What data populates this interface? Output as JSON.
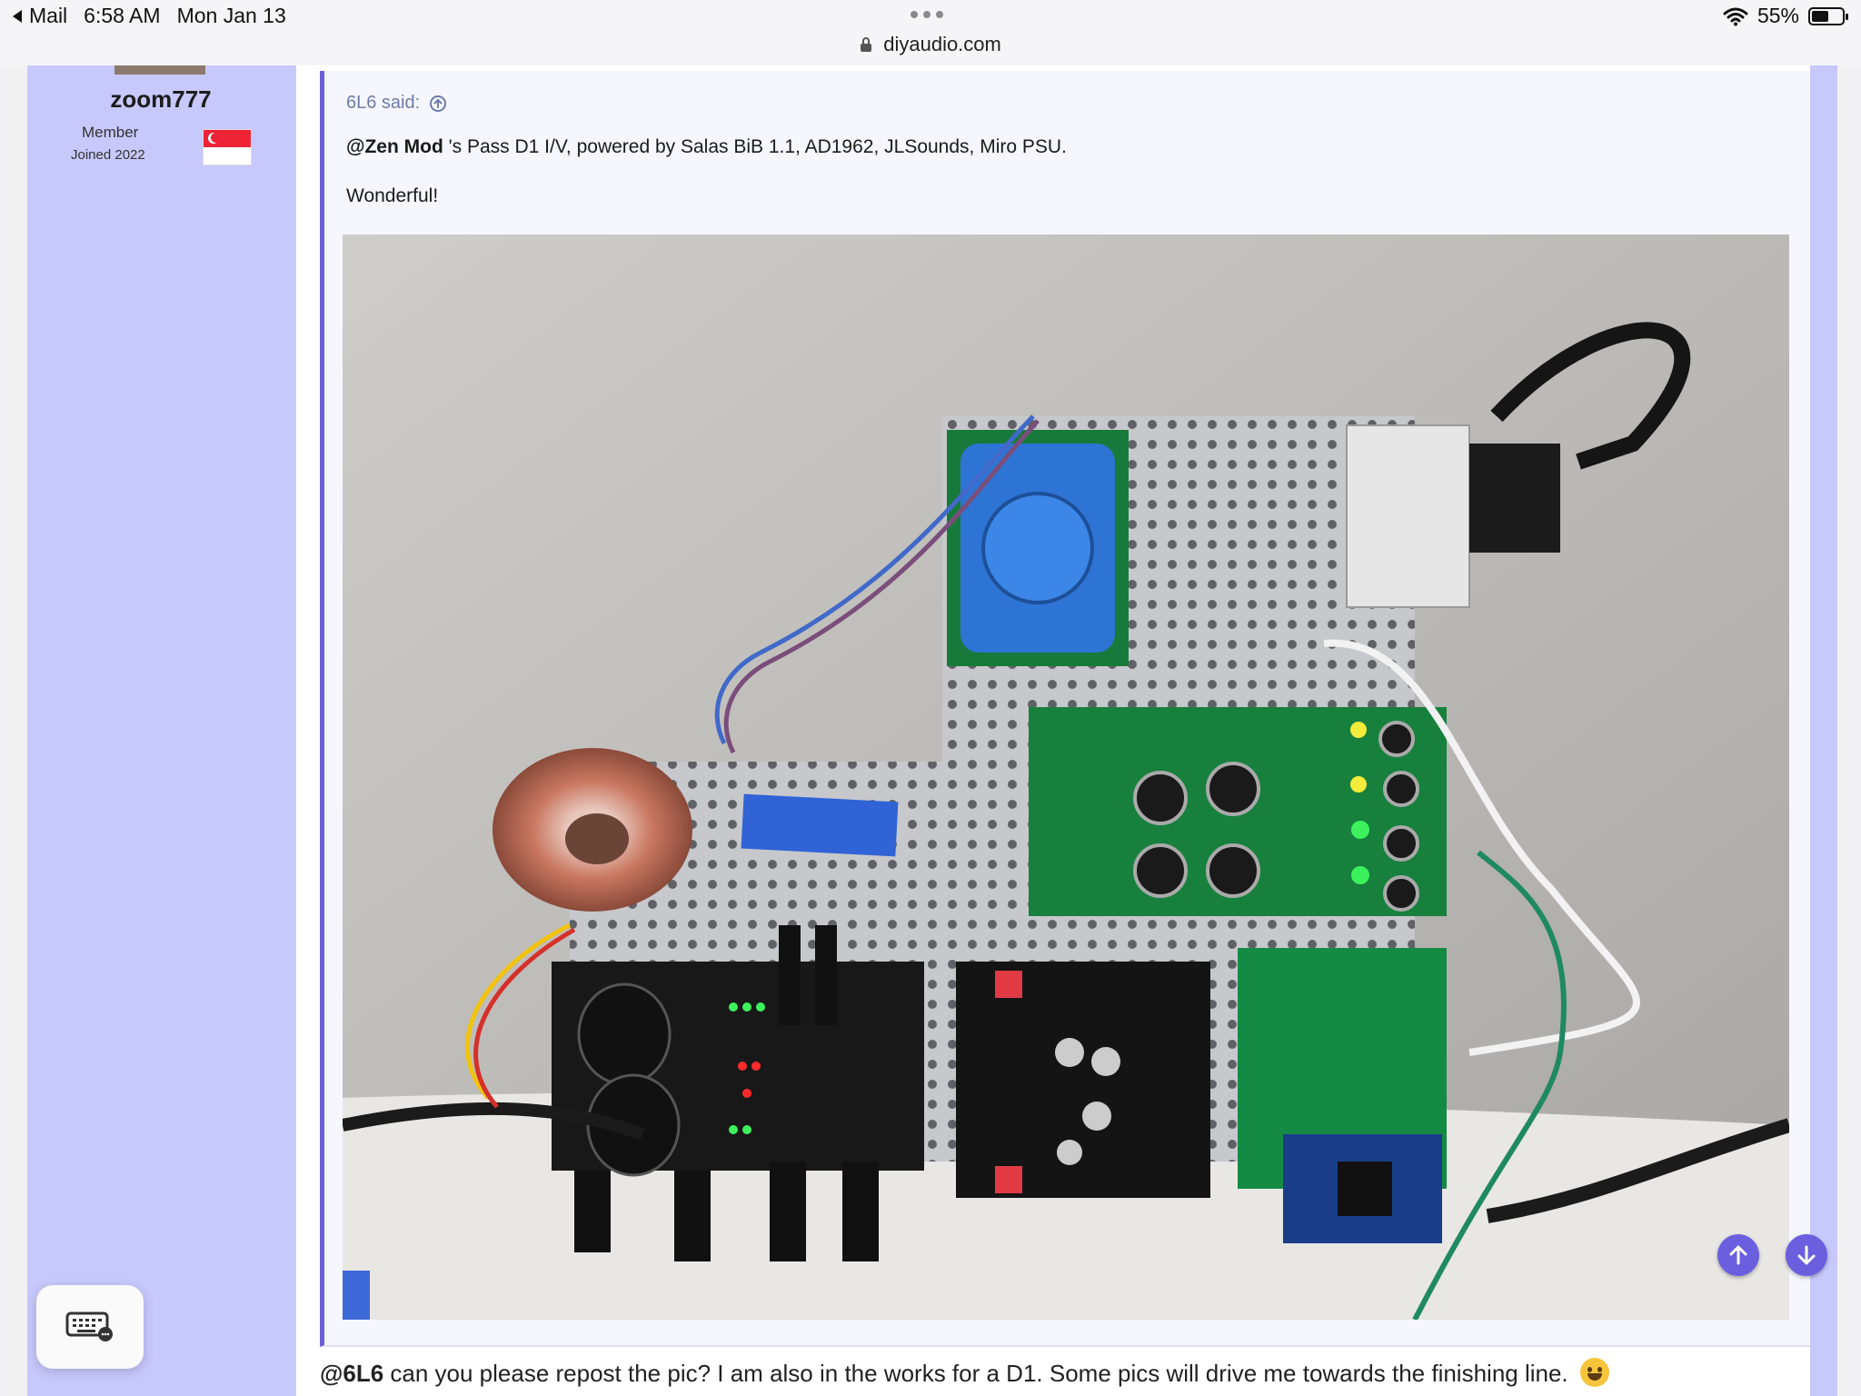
{
  "status_bar": {
    "back_app": "Mail",
    "time": "6:58 AM",
    "date": "Mon Jan 13",
    "url": "diyaudio.com",
    "battery": "55%",
    "battery_level": 0.55
  },
  "user": {
    "name": "zoom777",
    "role": "Member",
    "joined": "Joined 2022"
  },
  "quote": {
    "author_said": "6L6 said:",
    "mention": "@Zen Mod",
    "text": " 's Pass D1 I/V, powered by Salas BiB 1.1, AD1962, JLSounds, Miro PSU.",
    "text2": "Wonderful!"
  },
  "reply": {
    "mention": "@6L6",
    "text": " can you please repost the pic? I am also in the works for a D1. Some pics will drive me towards the finishing line."
  },
  "colors": {
    "sidebar": "#c7c8fc",
    "quote_border": "#6c5fd6",
    "nav_button": "#6b5fe0"
  }
}
